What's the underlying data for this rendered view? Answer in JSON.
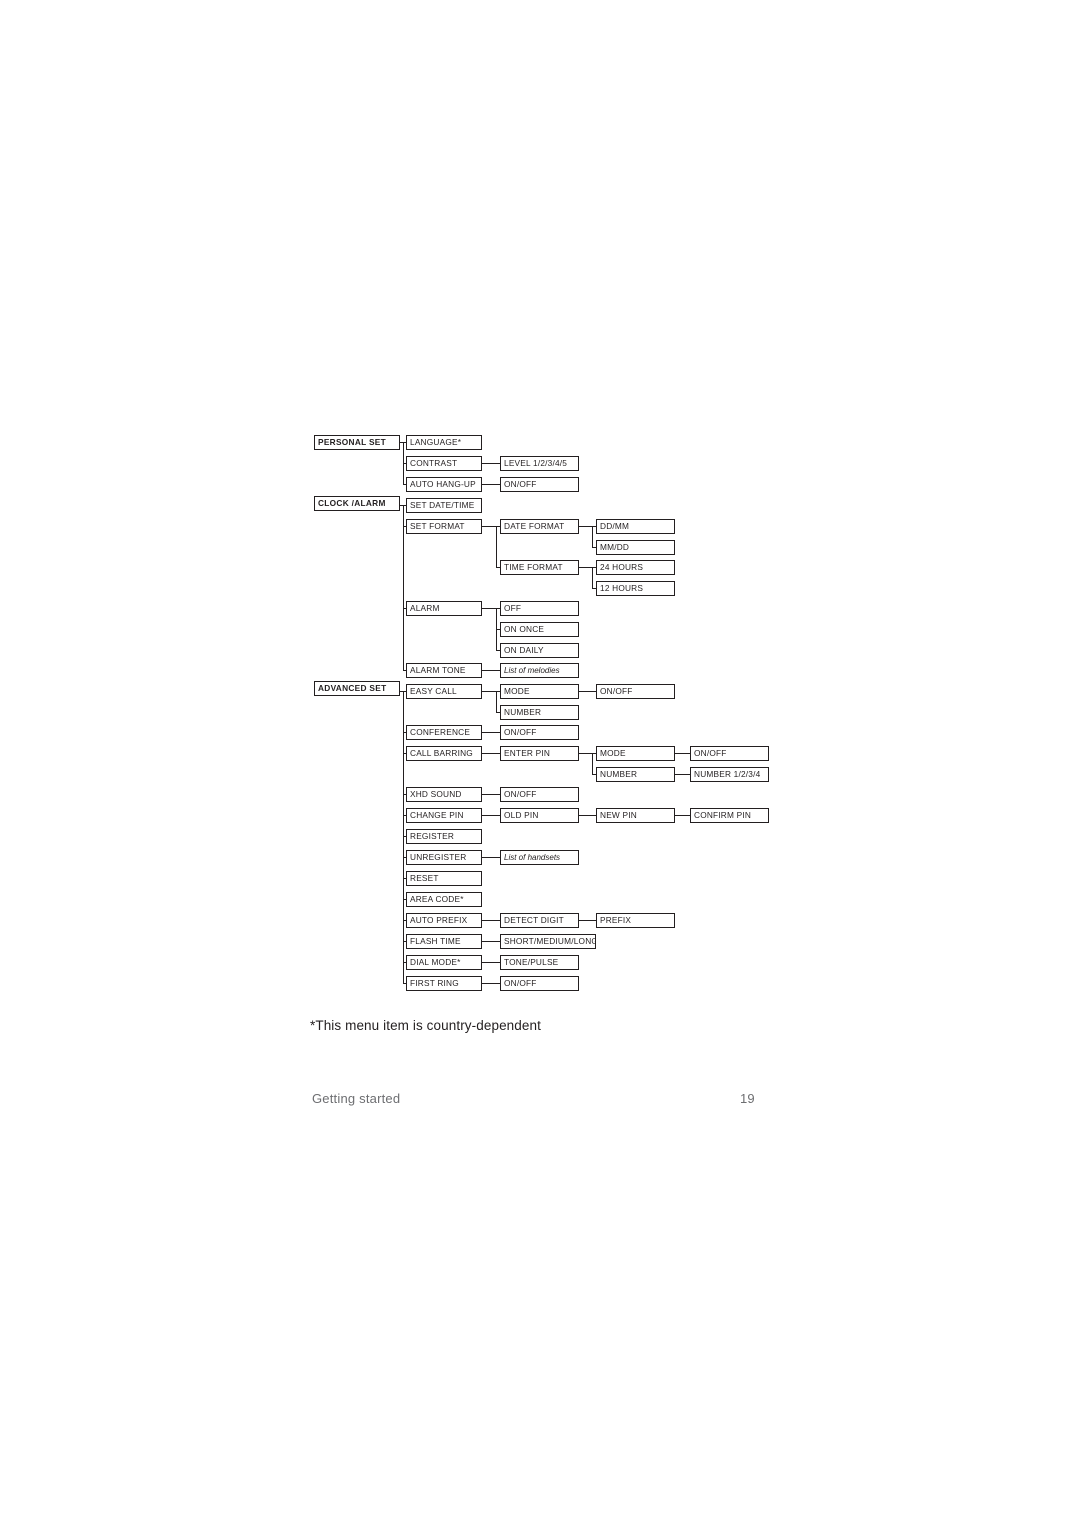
{
  "page": {
    "footnote": "*This menu item is country-dependent",
    "footer_left": "Getting started",
    "footer_right": "19"
  },
  "diagram": {
    "type": "menu-tree",
    "nodes": {
      "personal_set": "PERSONAL SET",
      "language": "LANGUAGE*",
      "contrast": "CONTRAST",
      "level": "LEVEL 1/2/3/4/5",
      "auto_hang_up": "AUTO HANG-UP",
      "auto_hang_up_onoff": "ON/OFF",
      "clock_alarm": "CLOCK /ALARM",
      "set_date_time": "SET DATE/TIME",
      "set_format": "SET FORMAT",
      "date_format": "DATE FORMAT",
      "dd_mm": "DD/MM",
      "mm_dd": "MM/DD",
      "time_format": "TIME FORMAT",
      "hours_24": "24 HOURS",
      "hours_12": "12 HOURS",
      "alarm": "ALARM",
      "alarm_off": "OFF",
      "alarm_on_once": "ON ONCE",
      "alarm_on_daily": "ON DAILY",
      "alarm_tone": "ALARM TONE",
      "list_of_melodies": "List of melodies",
      "advanced_set": "ADVANCED SET",
      "easy_call": "EASY CALL",
      "easy_call_mode": "MODE",
      "easy_call_mode_onoff": "ON/OFF",
      "easy_call_number": "NUMBER",
      "conference": "CONFERENCE",
      "conference_onoff": "ON/OFF",
      "call_barring": "CALL BARRING",
      "enter_pin": "ENTER PIN",
      "barring_mode": "MODE",
      "barring_mode_onoff": "ON/OFF",
      "barring_number": "NUMBER",
      "barring_number_1234": "NUMBER 1/2/3/4",
      "xhd_sound": "XHD SOUND",
      "xhd_sound_onoff": "ON/OFF",
      "change_pin": "CHANGE PIN",
      "old_pin": "OLD PIN",
      "new_pin": "NEW PIN",
      "confirm_pin": "CONFIRM PIN",
      "register": "REGISTER",
      "unregister": "UNREGISTER",
      "list_of_handsets": "List of handsets",
      "reset": "RESET",
      "area_code": "AREA CODE*",
      "auto_prefix": "AUTO PREFIX",
      "detect_digit": "DETECT DIGIT",
      "prefix": "PREFIX",
      "flash_time": "FLASH TIME",
      "flash_time_values": "SHORT/MEDIUM/LONG",
      "dial_mode": "DIAL MODE*",
      "tone_pulse": "TONE/PULSE",
      "first_ring": "FIRST RING",
      "first_ring_onoff": "ON/OFF"
    }
  }
}
